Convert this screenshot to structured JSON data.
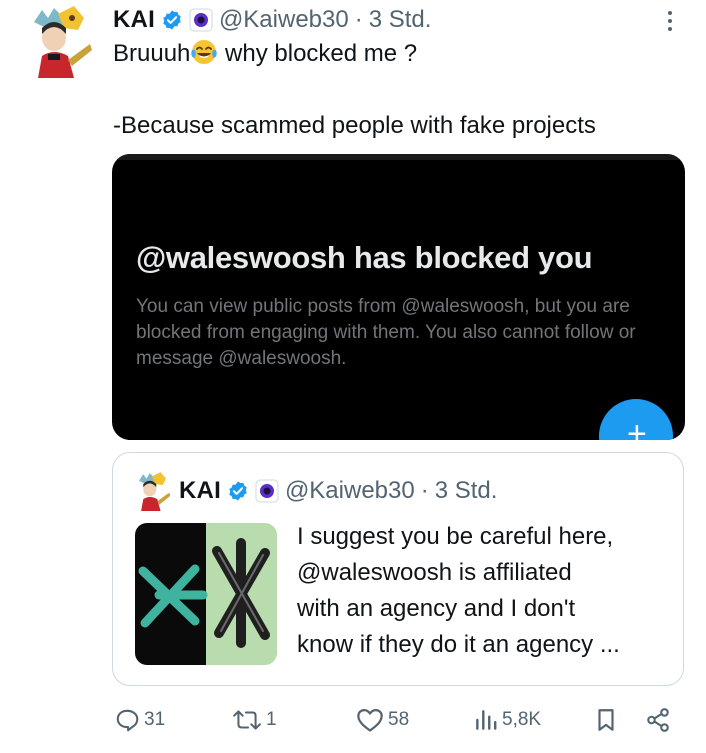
{
  "tweet": {
    "author": {
      "name": "KAI",
      "handle": "@Kaiweb30",
      "separator": "·",
      "time": "3 Std."
    },
    "text": {
      "line1_before_emoji": "Bruuuh",
      "emoji": "face-with-tears-of-joy",
      "line1_after_emoji": " why blocked me ?",
      "line2": "-Because scammed people with fake projects"
    },
    "media": {
      "title": "@waleswoosh has blocked you",
      "body": "You can view public posts from @waleswoosh, but you are blocked from engaging with them. You also cannot follow or message @waleswoosh.",
      "fab_icon": "plus-icon"
    },
    "quote": {
      "author": {
        "name": "KAI",
        "handle": "@Kaiweb30",
        "separator": "·",
        "time": "3 Std."
      },
      "lines": [
        "I suggest you be careful here,",
        "@waleswoosh is affiliated",
        "with an agency and I don't",
        "know if they do it an agency ..."
      ]
    },
    "actions": {
      "replies": "31",
      "reposts": "1",
      "likes": "58",
      "views": "5,8K"
    },
    "colors": {
      "accent": "#1d9bf0",
      "text": "#0f1419",
      "muted": "#536471",
      "border": "#cfd9de"
    }
  }
}
